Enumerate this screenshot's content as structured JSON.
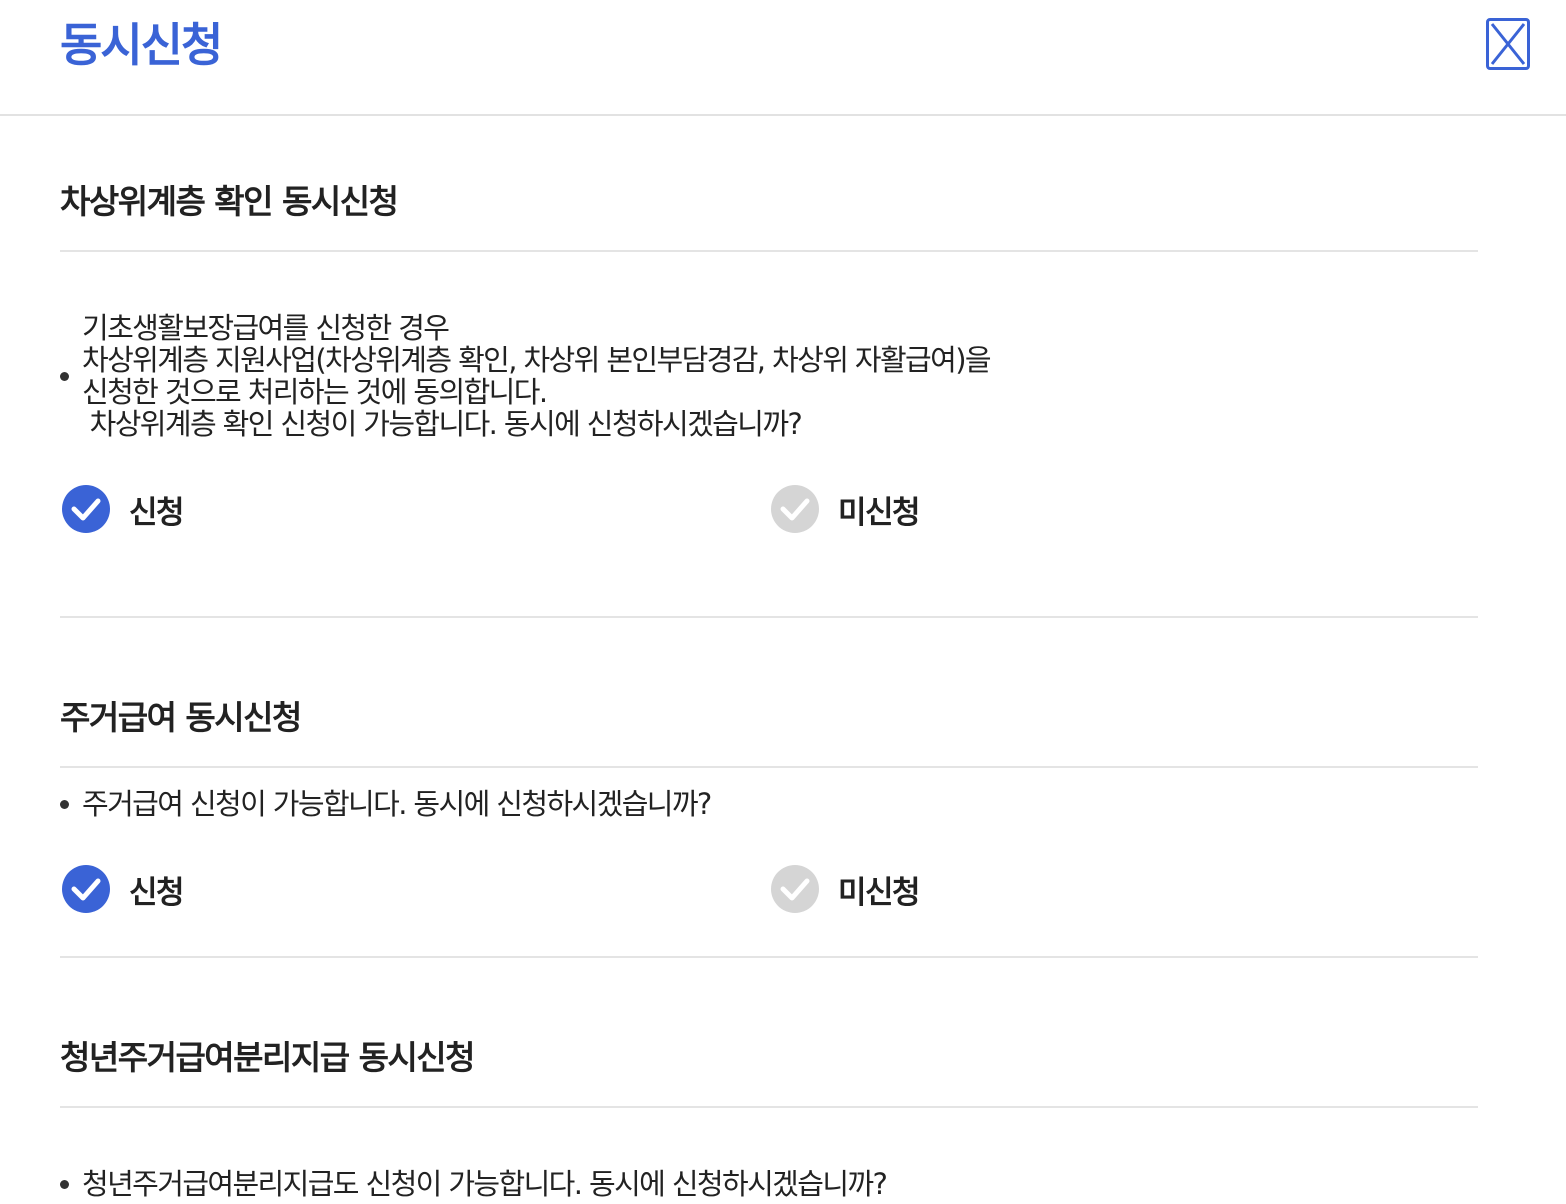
{
  "header": {
    "title": "동시신청",
    "close_icon": "close-icon"
  },
  "colors": {
    "accent": "#3a63d6",
    "unselected": "#d5d5d5",
    "divider": "#e4e4e4"
  },
  "sections": [
    {
      "title": "차상위계층 확인 동시신청",
      "description": "기초생활보장급여를 신청한 경우\n차상위계층 지원사업(차상위계층 확인, 차상위 본인부담경감, 차상위 자활급여)을\n신청한 것으로 처리하는 것에 동의합니다.\n 차상위계층 확인 신청이 가능합니다. 동시에 신청하시겠습니까?",
      "options": [
        {
          "label": "신청",
          "selected": true
        },
        {
          "label": "미신청",
          "selected": false
        }
      ]
    },
    {
      "title": "주거급여 동시신청",
      "description": "주거급여 신청이 가능합니다. 동시에 신청하시겠습니까?",
      "options": [
        {
          "label": "신청",
          "selected": true
        },
        {
          "label": "미신청",
          "selected": false
        }
      ]
    },
    {
      "title": "청년주거급여분리지급 동시신청",
      "description": "청년주거급여분리지급도 신청이 가능합니다. 동시에 신청하시겠습니까?"
    }
  ]
}
